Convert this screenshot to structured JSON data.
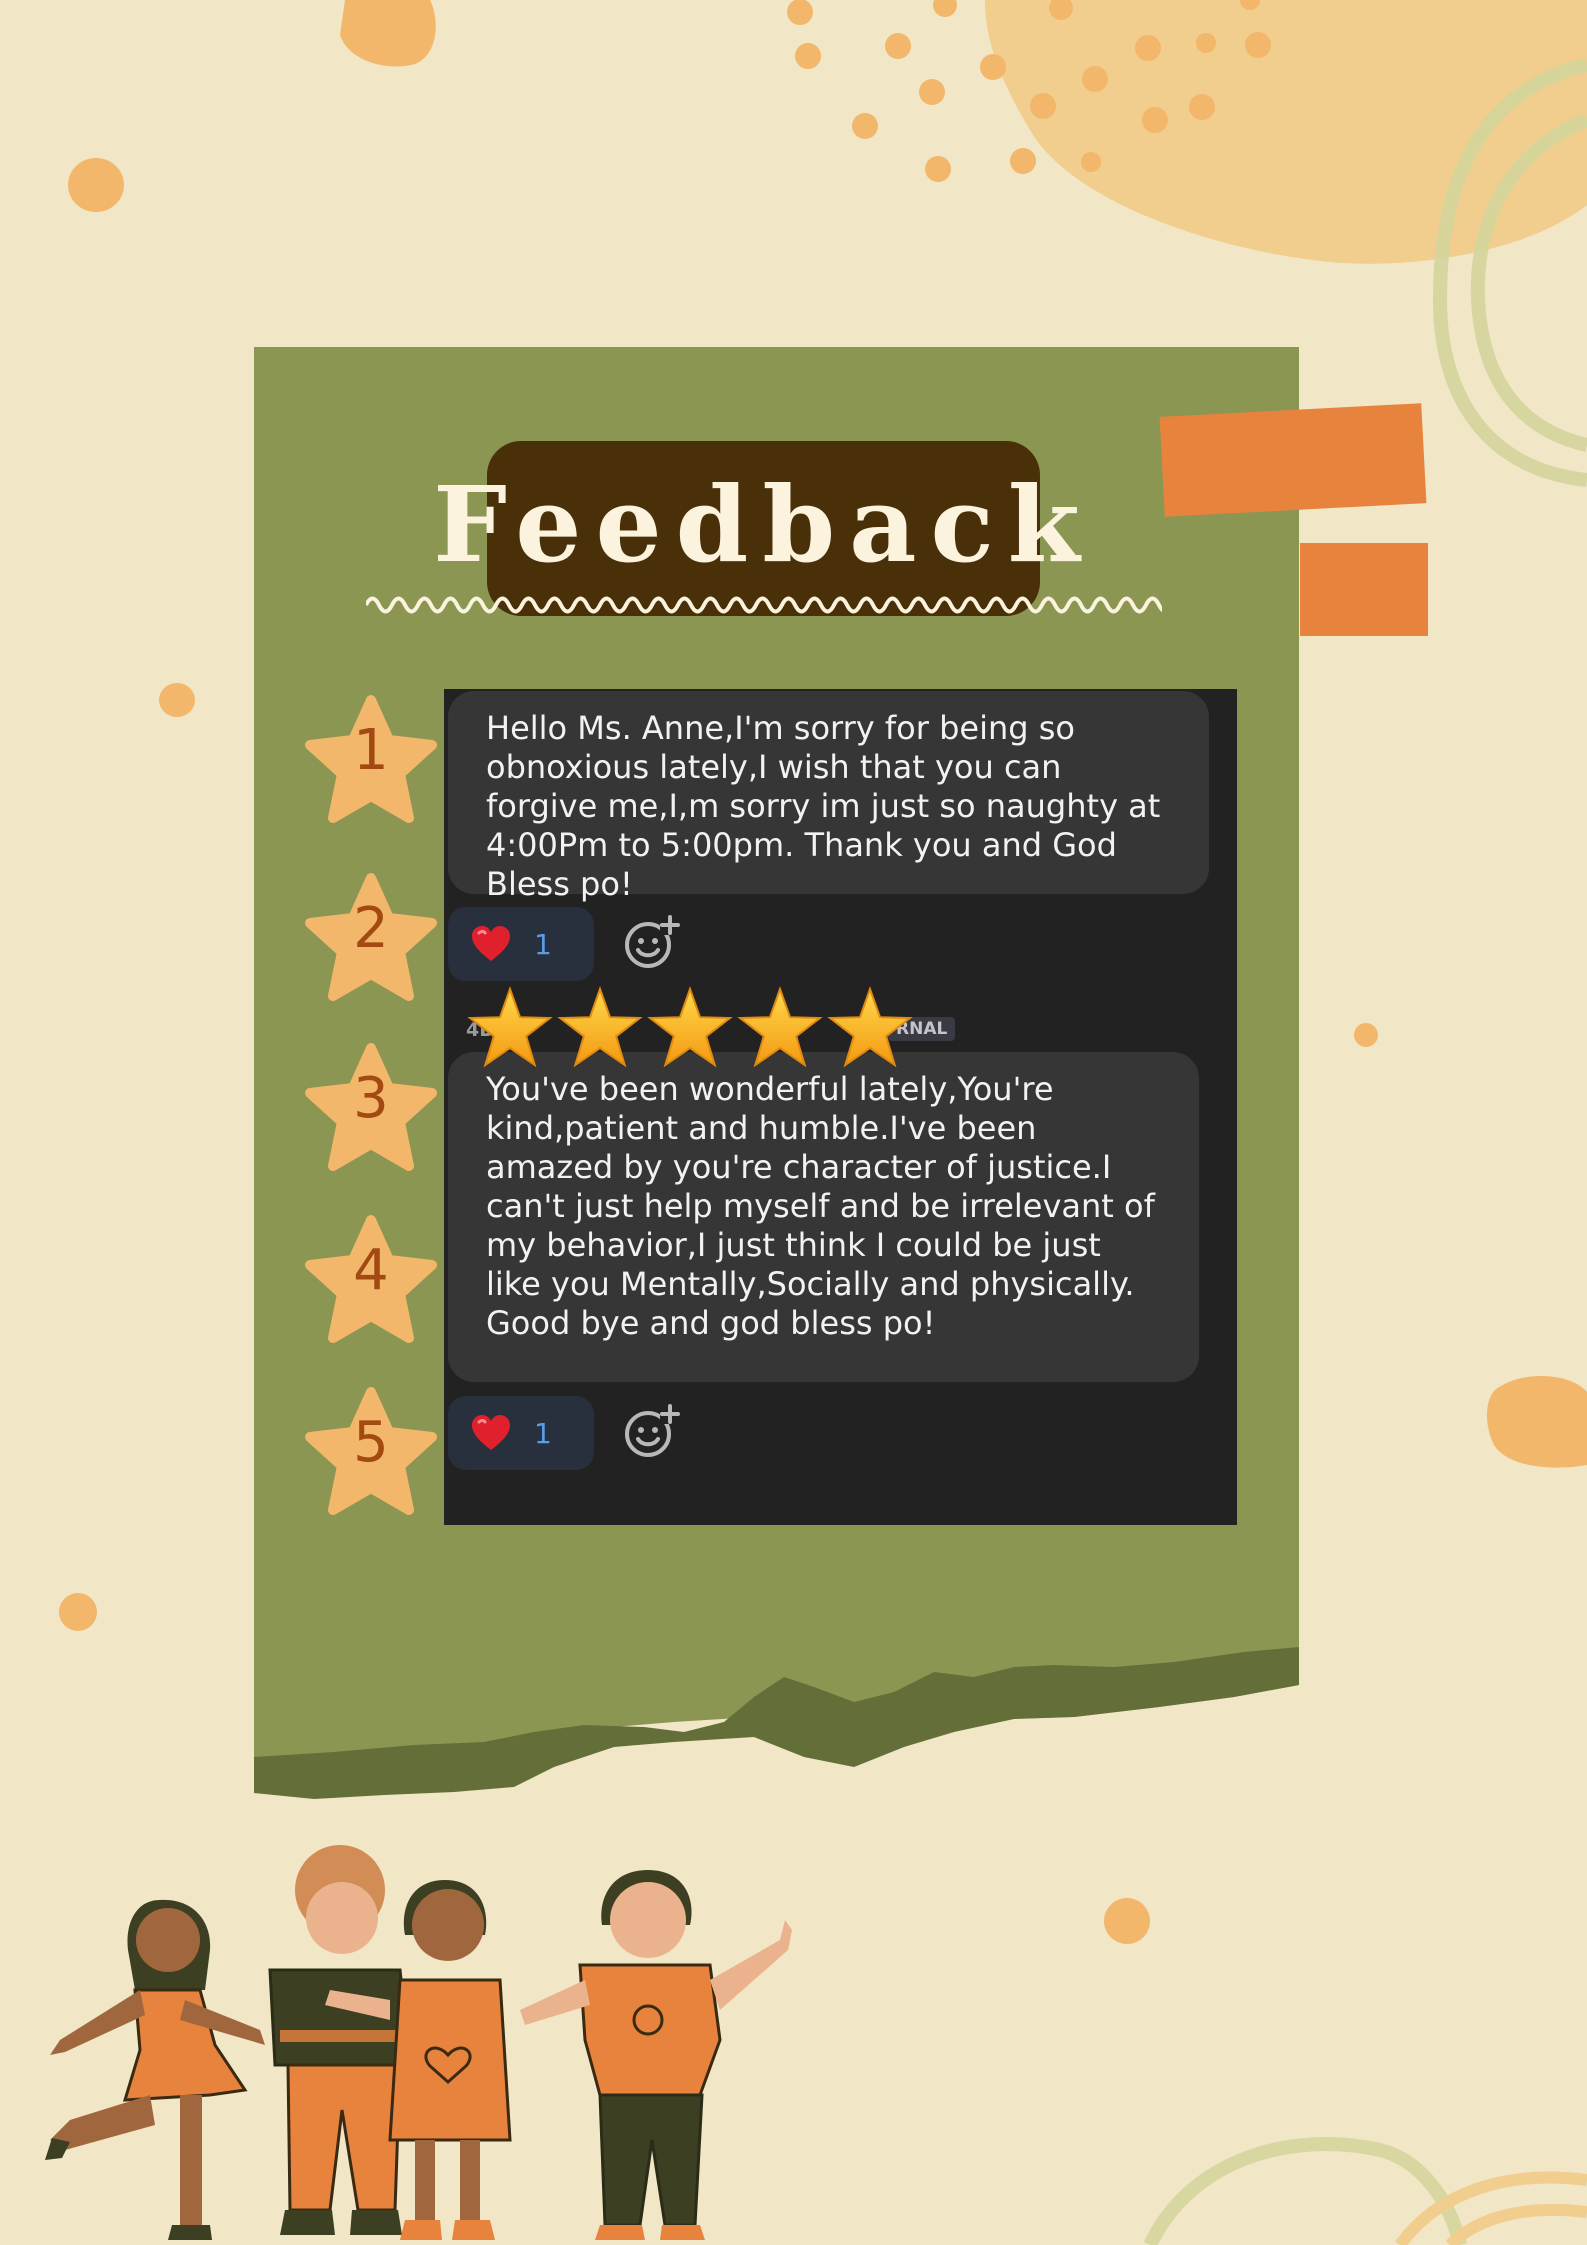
{
  "title": "Feedback",
  "numbers": [
    "1",
    "2",
    "3",
    "4",
    "5"
  ],
  "messages": [
    {
      "text": "Hello Ms. Anne,I'm sorry for being so obnoxious lately,I wish that you can forgive me,I,m sorry im just so naughty at 4:00Pm to 5:00pm. Thank you and God Bless po!",
      "reaction_count": "1"
    },
    {
      "sender": "4D",
      "tag": "RNAL",
      "text": "You've been wonderful lately,You're kind,patient and humble.I've been amazed by you're character of justice.I can't just help myself and be irrelevant of my behavior,I just think I could be just like you Mentally,Socially and physically. Good bye and god bless po!",
      "reaction_count": "1"
    }
  ],
  "rating": 5,
  "colors": {
    "background": "#f1e6c5",
    "card": "#8c9653",
    "title_box": "#4a3009",
    "accent_orange": "#e8833e",
    "star_badge": "#f2b76a",
    "number_color": "#a24a12"
  },
  "icons": [
    "heart-icon",
    "add-reaction-icon",
    "star-icon"
  ]
}
